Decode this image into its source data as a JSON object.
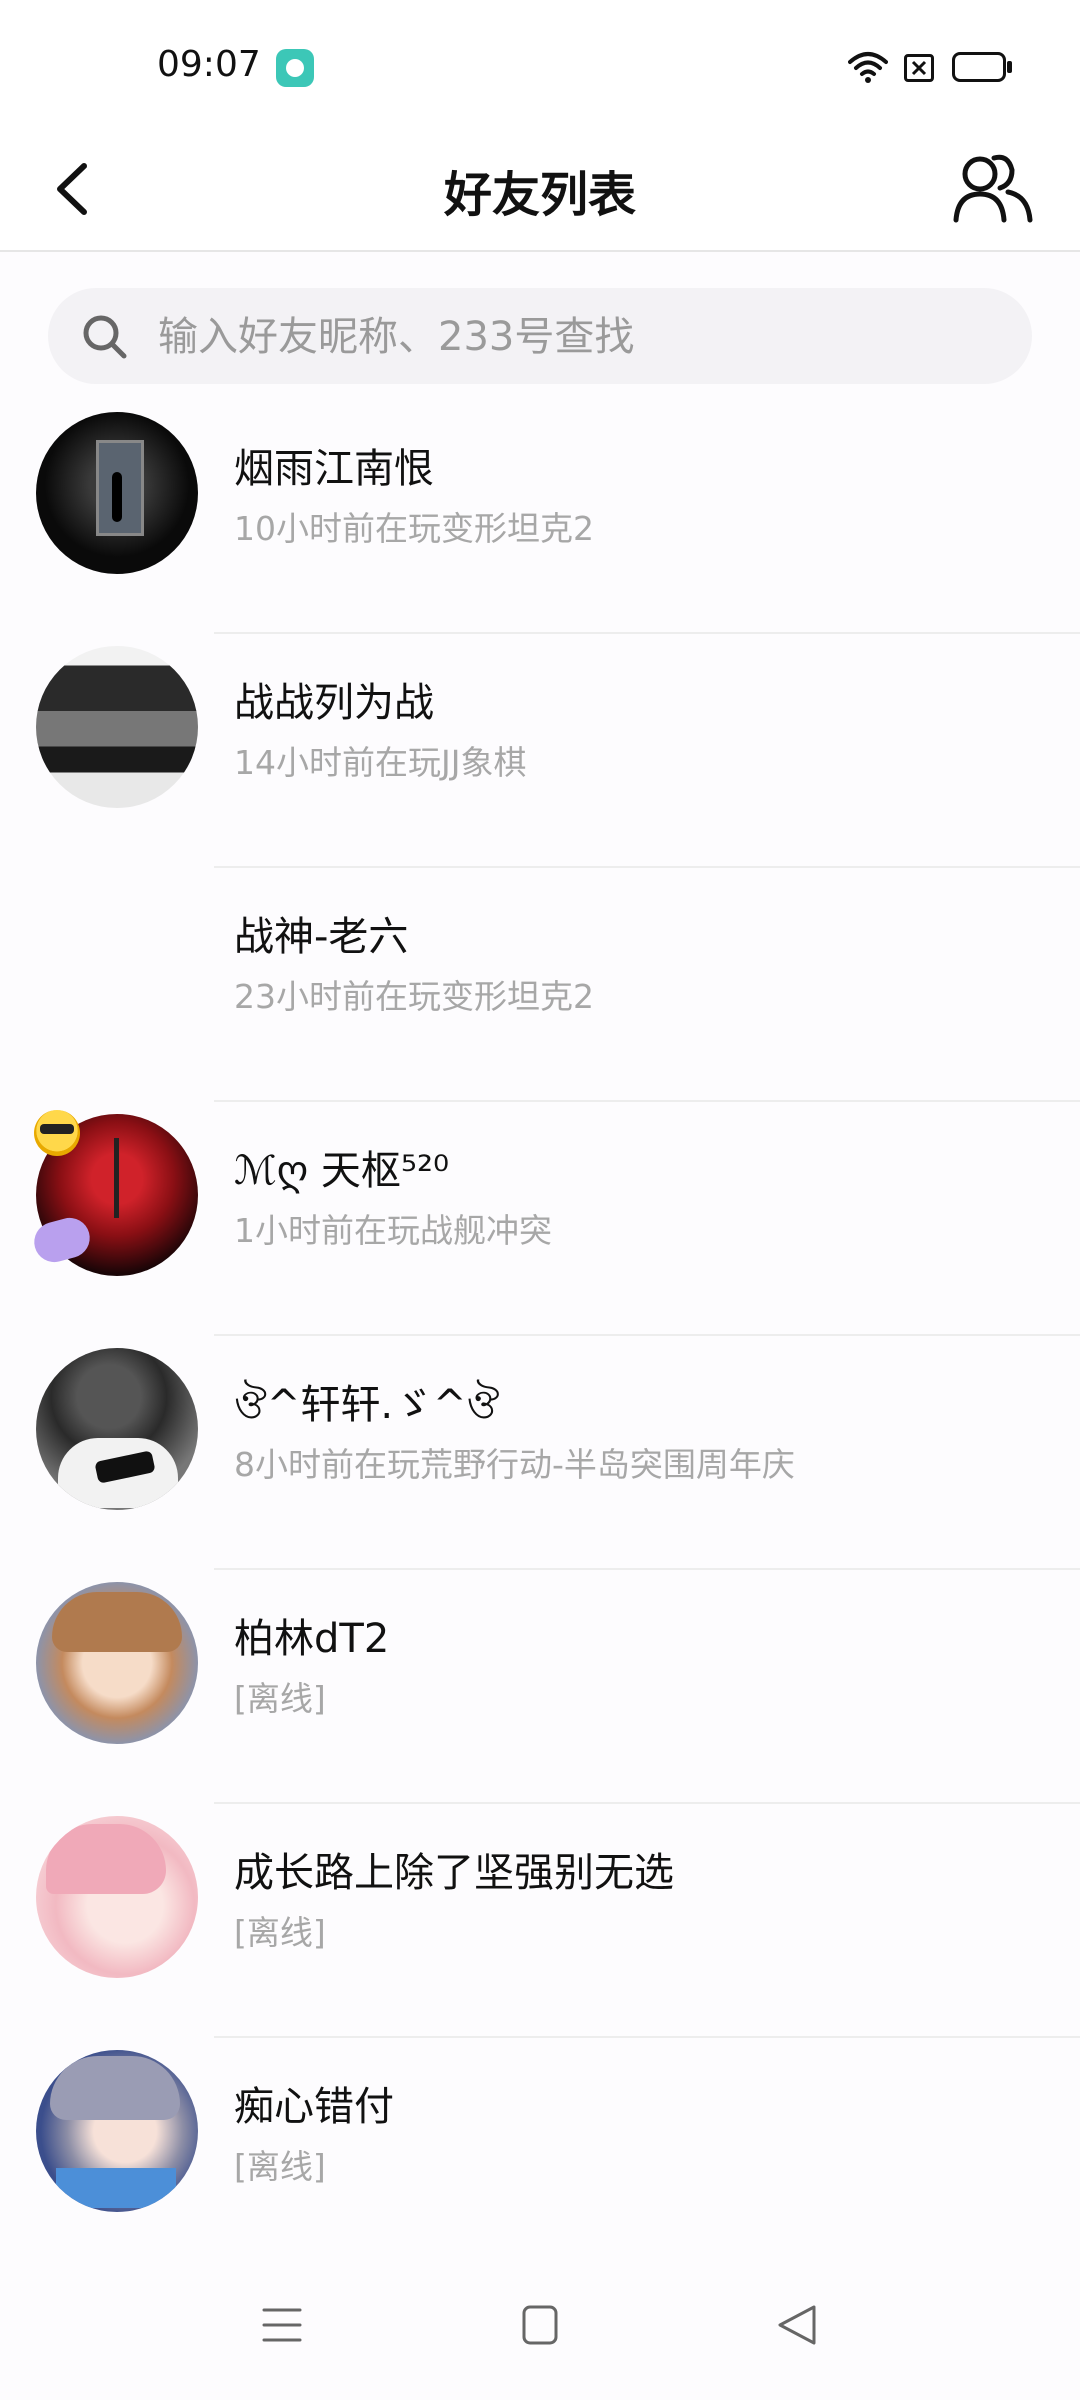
{
  "status_bar": {
    "time": "09:07"
  },
  "header": {
    "title": "好友列表"
  },
  "search": {
    "placeholder": "输入好友昵称、233号查找"
  },
  "friends": [
    {
      "name": "烟雨江南恨",
      "status": "10小时前在玩变形坦克2"
    },
    {
      "name": "战战列为战",
      "status": "14小时前在玩JJ象棋"
    },
    {
      "name": "战神-老六",
      "status": "23小时前在玩变形坦克2"
    },
    {
      "name": "ℳღ 天枢⁵²⁰",
      "status": "1小时前在玩战舰冲突"
    },
    {
      "name": "ঔ^轩轩.ゞ^ঔ",
      "status": "8小时前在玩荒野行动-半岛突围周年庆"
    },
    {
      "name": "柏林dT2",
      "status": "[离线]"
    },
    {
      "name": "成长路上除了坚强别无选",
      "status": "[离线]"
    },
    {
      "name": "痴心错付",
      "status": "[离线]"
    }
  ],
  "colors": {
    "accent_teal": "#3cc7b7",
    "battery_yellow": "#f7d774",
    "status_gray": "#a7a7a7"
  },
  "icons": {
    "back": "chevron-left-icon",
    "friends": "users-icon",
    "search": "search-icon",
    "nav_menu": "menu-icon",
    "nav_home": "home-square-icon",
    "nav_back": "triangle-back-icon"
  }
}
